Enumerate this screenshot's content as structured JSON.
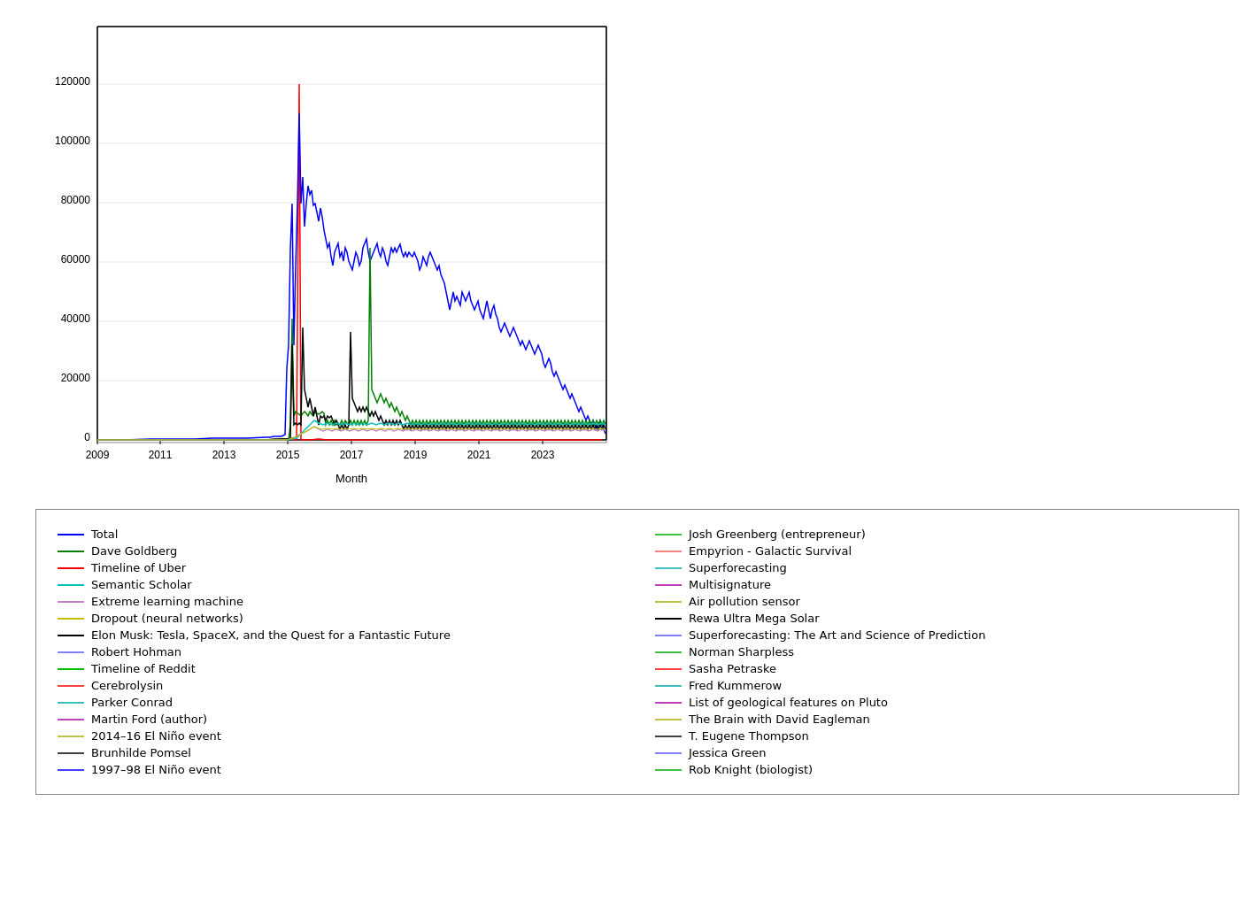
{
  "chart": {
    "title": "",
    "x_label": "Month",
    "y_ticks": [
      "0",
      "20000",
      "40000",
      "60000",
      "80000",
      "100000",
      "120000"
    ],
    "x_ticks": [
      "2009",
      "2011",
      "2013",
      "2015",
      "2017",
      "2019",
      "2021",
      "2023"
    ]
  },
  "legend": {
    "col1": [
      {
        "label": "Total",
        "color": "#0000ff"
      },
      {
        "label": "Dave Goldberg",
        "color": "#008000"
      },
      {
        "label": "Timeline of Uber",
        "color": "#ff0000"
      },
      {
        "label": "Semantic Scholar",
        "color": "#00bfbf"
      },
      {
        "label": "Extreme learning machine",
        "color": "#bf7fbf"
      },
      {
        "label": "Dropout (neural networks)",
        "color": "#bfbf00"
      },
      {
        "label": "Elon Musk: Tesla, SpaceX, and the Quest for a Fantastic Future",
        "color": "#000000"
      },
      {
        "label": "Robert Hohman",
        "color": "#7f7fff"
      },
      {
        "label": "Timeline of Reddit",
        "color": "#00bf00"
      },
      {
        "label": "Cerebrolysin",
        "color": "#ff4040"
      },
      {
        "label": "Parker Conrad",
        "color": "#40bfbf"
      },
      {
        "label": "Martin Ford (author)",
        "color": "#bf40bf"
      },
      {
        "label": "2014–16 El Niño event",
        "color": "#bfbf40"
      },
      {
        "label": "Brunhilde Pomsel",
        "color": "#404040"
      },
      {
        "label": "1997–98 El Niño event",
        "color": "#4040ff"
      }
    ],
    "col2": [
      {
        "label": "Josh Greenberg (entrepreneur)",
        "color": "#40bf40"
      },
      {
        "label": "Empyrion - Galactic Survival",
        "color": "#ff8080"
      },
      {
        "label": "Superforecasting",
        "color": "#40bfbf"
      },
      {
        "label": "Multisignature",
        "color": "#bf40bf"
      },
      {
        "label": "Air pollution sensor",
        "color": "#bfbf40"
      },
      {
        "label": "Rewa Ultra Mega Solar",
        "color": "#000000"
      },
      {
        "label": "Superforecasting: The Art and Science of Prediction",
        "color": "#7f7fff"
      },
      {
        "label": "Norman Sharpless",
        "color": "#40bf40"
      },
      {
        "label": "Sasha Petraske",
        "color": "#ff4040"
      },
      {
        "label": "Fred Kummerow",
        "color": "#40bfbf"
      },
      {
        "label": "List of geological features on Pluto",
        "color": "#bf40bf"
      },
      {
        "label": "The Brain with David Eagleman",
        "color": "#bfbf40"
      },
      {
        "label": "T. Eugene Thompson",
        "color": "#404040"
      },
      {
        "label": "Jessica Green",
        "color": "#7f7fff"
      },
      {
        "label": "Rob Knight (biologist)",
        "color": "#40bf40"
      }
    ]
  }
}
